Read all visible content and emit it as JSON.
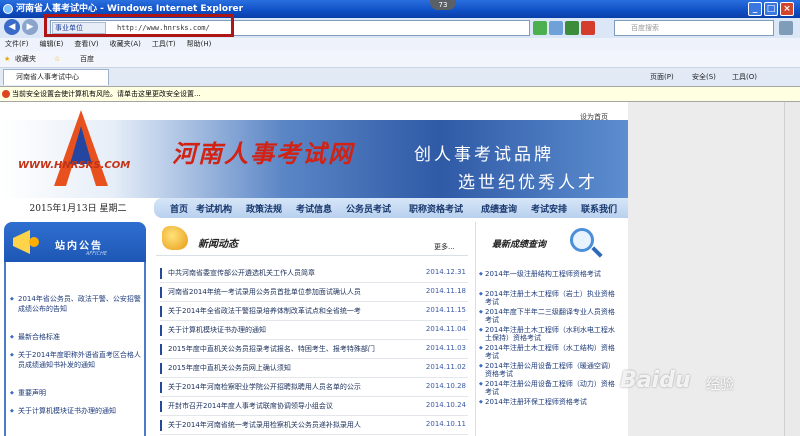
{
  "window": {
    "title": "河南省人事考试中心 - Windows Internet Explorer",
    "badge": "73"
  },
  "address": {
    "tag": "事业单位",
    "url": "http://www.hnrsks.com/"
  },
  "search": {
    "placeholder": "百度搜索"
  },
  "menu": [
    "文件(F)",
    "编辑(E)",
    "查看(V)",
    "收藏夹(A)",
    "工具(T)",
    "帮助(H)"
  ],
  "favbar": {
    "favorites": "收藏夹",
    "baidu": "百度"
  },
  "tab": {
    "label": "河南省人事考试中心"
  },
  "commands": {
    "page": "页面(P)",
    "safety": "安全(S)",
    "tools": "工具(O)"
  },
  "infobar": "当前安全设置会使计算机有风险。请单击这里更改安全设置...",
  "site": {
    "sethome": "设为首页",
    "logo_text": "WWW.HNRSKS.COM",
    "title": "河南人事考试网",
    "slogan1": "创人事考试品牌",
    "slogan2": "选世纪优秀人才",
    "date": "2015年1月13日 星期二",
    "nav": [
      "首页",
      "考试机构",
      "政策法规",
      "考试信息",
      "公务员考试",
      "职称资格考试",
      "成绩查询",
      "考试安排",
      "联系我们"
    ],
    "notice_title": "站内公告",
    "notice_sub": "AFFICHE",
    "notices": [
      "2014年省公务员、政法干警、公安招警成绩公布的告知",
      "最新合格标准",
      "关于2014年度职称外语省直考区合格人员成绩通知书补发的通知",
      "重要声明",
      "关于计算机模块证书办理的通知"
    ],
    "news_title": "新闻动态",
    "more": "更多...",
    "news": [
      {
        "title": "中共河南省委宣传部公开遴选机关工作人员简章",
        "date": "2014.12.31"
      },
      {
        "title": "河南省2014年统一考试录用公务员首批单位参加面试确认人员",
        "date": "2014.11.18"
      },
      {
        "title": "关于2014年全省政法干警招录培养体制改革试点和全省统一考",
        "date": "2014.11.15"
      },
      {
        "title": "关于计算机模块证书办理的通知",
        "date": "2014.11.04"
      },
      {
        "title": "2015年度中直机关公务员招录考试报名、特困考生、报考特殊部门",
        "date": "2014.11.03"
      },
      {
        "title": "2015年度中直机关公务员网上确认须知",
        "date": "2014.11.02"
      },
      {
        "title": "关于2014年河南检察职业学院公开招聘拟聘用人员名单的公示",
        "date": "2014.10.28"
      },
      {
        "title": "开封市召开2014年度人事考试联席协调领导小组会议",
        "date": "2014.10.24"
      },
      {
        "title": "关于2014年河南省统一考试录用检察机关公务员递补拟录用人",
        "date": "2014.10.11"
      }
    ],
    "results_title": "最新成绩查询",
    "results": [
      "2014年一级注册结构工程师资格考试",
      "2014年注册土木工程师（岩土）执业资格考试",
      "2014年度下半年二三级翻译专业人员资格考试",
      "2014年注册土木工程师（水利水电工程水土保持）资格考试",
      "2014年注册土木工程师（水工结构）资格考试",
      "2014年注册公用设备工程师（暖通空调）资格考试",
      "2014年注册公用设备工程师（动力）资格考试",
      "2014年注册环保工程师资格考试"
    ]
  },
  "watermark": {
    "brand": "Baidu",
    "text": "经验"
  }
}
